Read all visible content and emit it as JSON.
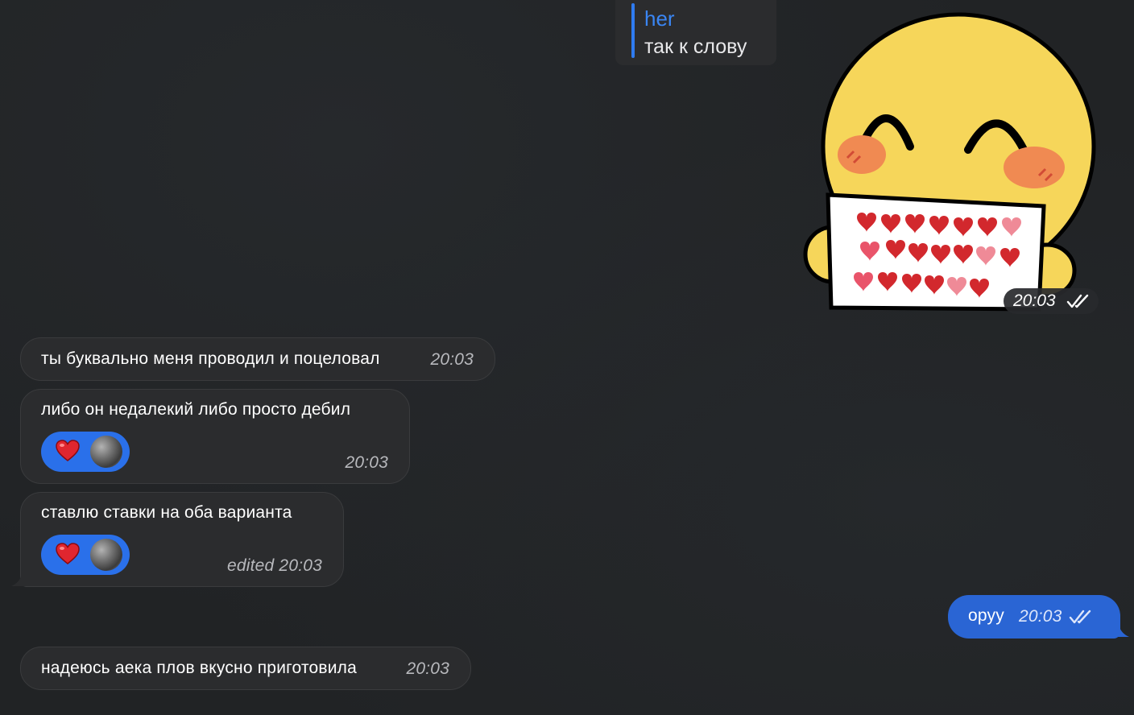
{
  "reply": {
    "name": "her",
    "text": "так к слову"
  },
  "sticker": {
    "time": "20:03"
  },
  "messages": [
    {
      "text": "ты буквально меня проводил и поцеловал",
      "time": "20:03"
    },
    {
      "text": "либо он недалекий либо просто дебил",
      "time": "20:03",
      "reaction": "heart"
    },
    {
      "text": "ставлю ставки на оба варианта",
      "time": "edited 20:03",
      "reaction": "heart"
    },
    {
      "text": "надеюсь аека плов вкусно приготовила",
      "time": "20:03"
    }
  ],
  "outgoing": {
    "text": "оруу",
    "time": "20:03"
  },
  "colors": {
    "background": "#212325",
    "incoming_bubble": "#2b2c2e",
    "outgoing_bubble": "#2a65d4",
    "accent": "#2f7bf0"
  }
}
